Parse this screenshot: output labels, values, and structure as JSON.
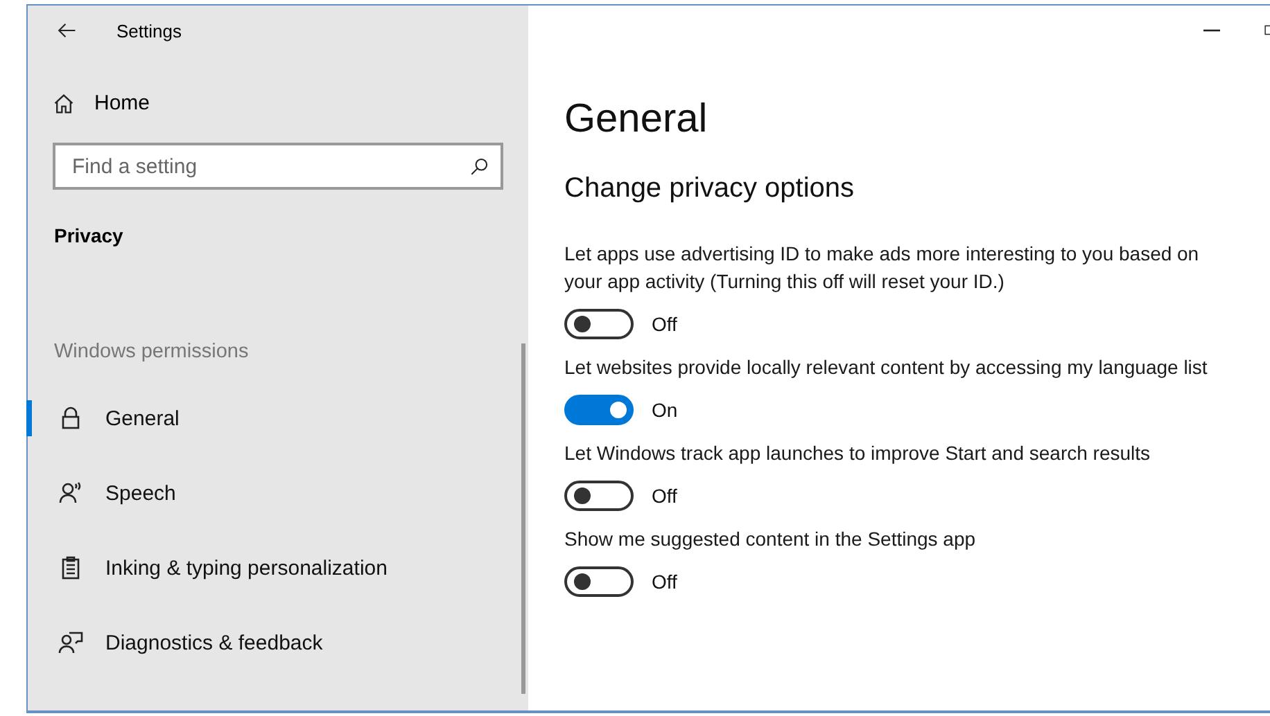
{
  "window": {
    "title": "Settings"
  },
  "sidebar": {
    "home": "Home",
    "search": {
      "placeholder": "Find a setting"
    },
    "category": "Privacy",
    "section": "Windows permissions",
    "items": [
      {
        "label": "General",
        "selected": true
      },
      {
        "label": "Speech",
        "selected": false
      },
      {
        "label": "Inking & typing personalization",
        "selected": false
      },
      {
        "label": "Diagnostics & feedback",
        "selected": false
      }
    ]
  },
  "content": {
    "title": "General",
    "subtitle": "Change privacy options",
    "options": [
      {
        "description": "Let apps use advertising ID to make ads more interesting to you based on your app activity (Turning this off will reset your ID.)",
        "on": false,
        "state": "Off"
      },
      {
        "description": "Let websites provide locally relevant content by accessing my language list",
        "on": true,
        "state": "On"
      },
      {
        "description": "Let Windows track app launches to improve Start and search results",
        "on": false,
        "state": "Off"
      },
      {
        "description": "Show me suggested content in the Settings app",
        "on": false,
        "state": "Off"
      }
    ]
  }
}
